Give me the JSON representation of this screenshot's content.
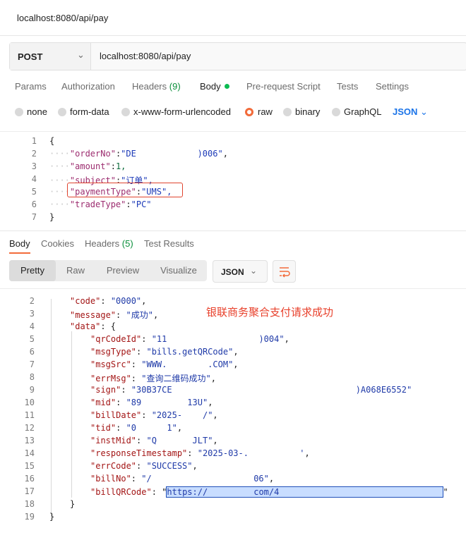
{
  "topbar": {
    "tab_title": "localhost:8080/api/pay"
  },
  "request": {
    "method": "POST",
    "url": "localhost:8080/api/pay",
    "tabs": {
      "params": "Params",
      "authorization": "Authorization",
      "headers_label": "Headers",
      "headers_count": "(9)",
      "body": "Body",
      "prerequest": "Pre-request Script",
      "tests": "Tests",
      "settings": "Settings"
    },
    "body_types": {
      "none": "none",
      "form_data": "form-data",
      "urlencoded": "x-www-form-urlencoded",
      "raw": "raw",
      "binary": "binary",
      "graphql": "GraphQL",
      "json": "JSON"
    },
    "editor": {
      "line_numbers": [
        "1",
        "2",
        "3",
        "4",
        "5",
        "6",
        "7"
      ],
      "lines": {
        "l1": "{",
        "l2_key": "\"orderNo\"",
        "l2_val_a": "\"DE",
        "l2_val_b": ")006\"",
        "l3_key": "\"amount\"",
        "l3_val": "1,",
        "l4_key": "\"subject\"",
        "l4_val": "\"订单\",",
        "l5_key": "\"paymentType\"",
        "l5_val": "\"UMS\",",
        "l6_key": "\"tradeType\"",
        "l6_val": "\"PC\"",
        "l7": "}"
      }
    }
  },
  "response": {
    "tabs": {
      "body": "Body",
      "cookies": "Cookies",
      "headers_label": "Headers",
      "headers_count": "(5)",
      "test_results": "Test Results"
    },
    "views": {
      "pretty": "Pretty",
      "raw": "Raw",
      "preview": "Preview",
      "visualize": "Visualize"
    },
    "format": "JSON",
    "annotation": "银联商务聚合支付请求成功",
    "line_numbers": [
      "2",
      "3",
      "4",
      "5",
      "6",
      "7",
      "8",
      "9",
      "10",
      "11",
      "12",
      "13",
      "14",
      "15",
      "16",
      "17",
      "18",
      "19"
    ],
    "lines": {
      "code_key": "\"code\"",
      "code_val": "\"0000\"",
      "message_key": "\"message\"",
      "message_val": "\"成功\"",
      "data_key": "\"data\"",
      "qrCodeId_key": "\"qrCodeId\"",
      "qrCodeId_val_a": "\"11",
      "qrCodeId_val_b": ")004\"",
      "msgType_key": "\"msgType\"",
      "msgType_val": "\"bills.getQRCode\"",
      "msgSrc_key": "\"msgSrc\"",
      "msgSrc_val_a": "\"WWW.",
      "msgSrc_val_b": ".COM\"",
      "errMsg_key": "\"errMsg\"",
      "errMsg_val": "\"查询二维码成功\"",
      "sign_key": "\"sign\"",
      "sign_val_a": "\"30B37CE",
      "sign_val_b": ")A068E6552\"",
      "mid_key": "\"mid\"",
      "mid_val_a": "\"89",
      "mid_val_b": "13U\"",
      "billDate_key": "\"billDate\"",
      "billDate_val_a": "\"2025-",
      "billDate_val_b": "/\"",
      "tid_key": "\"tid\"",
      "tid_val_a": "\"0",
      "tid_val_b": "1\"",
      "instMid_key": "\"instMid\"",
      "instMid_val_a": "\"Q",
      "instMid_val_b": "JLT\"",
      "responseTimestamp_key": "\"responseTimestamp\"",
      "responseTimestamp_val_a": "\"2025-03-.",
      "responseTimestamp_val_b": "'",
      "errCode_key": "\"errCode\"",
      "errCode_val": "\"SUCCESS\"",
      "billNo_key": "\"billNo\"",
      "billNo_val_a": "\"/",
      "billNo_val_b": "06\"",
      "billQRCode_key": "\"billQRCode\"",
      "billQRCode_val_a": "https://",
      "billQRCode_val_b": "com/4",
      "close_data": "}",
      "close_root": "}"
    }
  }
}
